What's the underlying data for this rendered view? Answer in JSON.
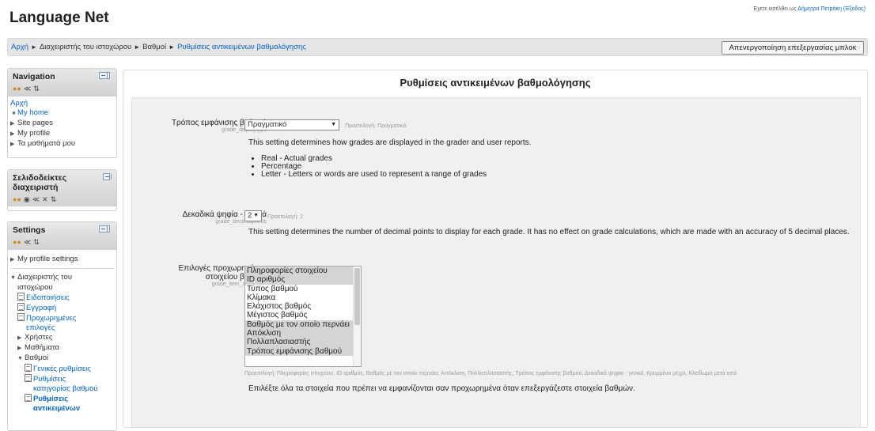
{
  "header": {
    "site_title": "Language Net",
    "login_prefix": "Έχετε εισέλθει ως",
    "user_name": "Δήμητρα Πετράκη",
    "logout": "(Έξοδος)"
  },
  "navbar": {
    "breadcrumb": [
      "Αρχή",
      "Διαχειριστής του ιστοχώρου",
      "Βαθμοί",
      "Ρυθμίσεις αντικειμένων βαθμολόγησης"
    ],
    "separator": "►",
    "button_label": "Απενεργοποίηση επεξεργασίας μπλοκ"
  },
  "navigation_block": {
    "title": "Navigation",
    "items": [
      {
        "label": "Αρχή",
        "type": "link"
      },
      {
        "label": "My home",
        "type": "bullet-link"
      },
      {
        "label": "Site pages",
        "type": "collapsed"
      },
      {
        "label": "My profile",
        "type": "collapsed"
      },
      {
        "label": "Τα μαθήματά μου",
        "type": "collapsed"
      }
    ]
  },
  "bookmarks_block": {
    "title_line1": "Σελιδοδείκτες",
    "title_line2": "διαχειριστή"
  },
  "settings_block": {
    "title": "Settings",
    "my_profile_settings": "My profile settings",
    "site_admin_line1": "Διαχειριστής του",
    "site_admin_line2": "ιστοχώρου",
    "notifications": "Ειδοποιήσεις",
    "registration": "Εγγραφή",
    "advanced_line1": "Προχωρημένες",
    "advanced_line2": "επιλογές",
    "users": "Χρήστες",
    "courses": "Μαθήματα",
    "grades": "Βαθμοί",
    "general_settings": "Γενικές ρυθμίσεις",
    "cat_settings_line1": "Ρυθμίσεις",
    "cat_settings_line2": "κατηγορίας βαθμού",
    "item_settings_line1": "Ρυθμίσεις",
    "item_settings_line2": "αντικειμένων"
  },
  "main": {
    "heading": "Ρυθμίσεις αντικειμένων βαθμολόγησης",
    "display_type": {
      "label": "Τρόπος εμφάνισης βαθμού",
      "key": "grade_displaytype",
      "value": "Πραγματικό",
      "default": "Προεπιλογή: Πραγματικό",
      "description": "This setting determines how grades are displayed in the grader and user reports.",
      "options": [
        "Real - Actual grades",
        "Percentage",
        "Letter - Letters or words are used to represent a range of grades"
      ]
    },
    "decimal_points": {
      "label": "Δεκαδικά ψηφία - γενικά",
      "key": "grade_decimalpoints",
      "value": "2",
      "default": "Προεπιλογή: 2",
      "description": "This setting determines the number of decimal points to display for each grade. It has no effect on grade calculations, which are made with an accuracy of 5 decimal places."
    },
    "item_advanced": {
      "label_line1": "Επιλογές προχωρημένου",
      "label_line2": "στοιχείου βαθμού",
      "key": "grade_item_advanced",
      "list_options": [
        {
          "label": "Πληροφορίες στοιχείου",
          "selected": true
        },
        {
          "label": "ID αριθμός",
          "selected": true
        },
        {
          "label": "Τύπος βαθμού",
          "selected": false
        },
        {
          "label": "Κλίμακα",
          "selected": false
        },
        {
          "label": "Ελάχιστος βαθμός",
          "selected": false
        },
        {
          "label": "Μέγιστος βαθμός",
          "selected": false
        },
        {
          "label": "Βαθμός με τον οποίο περνάει",
          "selected": true
        },
        {
          "label": "Απόκλιση",
          "selected": true
        },
        {
          "label": "Πολλαπλασιαστής",
          "selected": true
        },
        {
          "label": "Τρόπος εμφάνισης βαθμού",
          "selected": true
        }
      ],
      "default": "Προεπιλογή: Πληροφορίες στοιχείου, ID αριθμός, Βαθμός με τον οποίο περνάει, Απόκλιση, Πολλαπλασιαστής, Τρόπος εμφάνισης βαθμού, Δεκαδικά ψηφία - γενικά, Κρυμμένο μέχρι, Κλείδωμα μετά από",
      "description": "Επιλέξτε όλα τα στοιχεία που πρέπει να εμφανίζονται σαν προχωρημένα όταν επεξεργάζεστε στοιχεία βαθμών."
    }
  }
}
